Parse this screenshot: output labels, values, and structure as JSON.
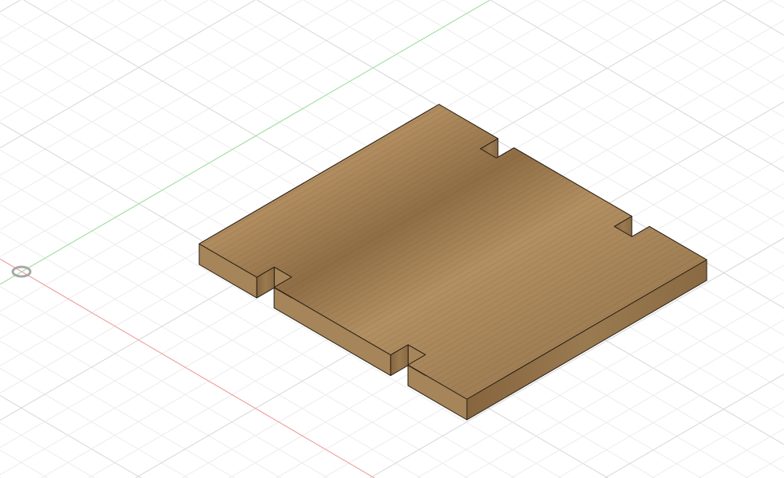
{
  "viewport": {
    "background": "#ffffff",
    "grid_minor_color": "#ececec",
    "grid_major_color": "#d6d6d6",
    "x_axis_color": "#f29a9a",
    "y_axis_color": "#9be39b",
    "origin_icon": "origin-marker-icon"
  },
  "body": {
    "material": "wood",
    "top_color": "#a98659",
    "top_dark_color": "#8c6a42",
    "side_left_color": "#8f6e47",
    "side_right_color": "#a58559",
    "edge_color": "#2a2016"
  }
}
